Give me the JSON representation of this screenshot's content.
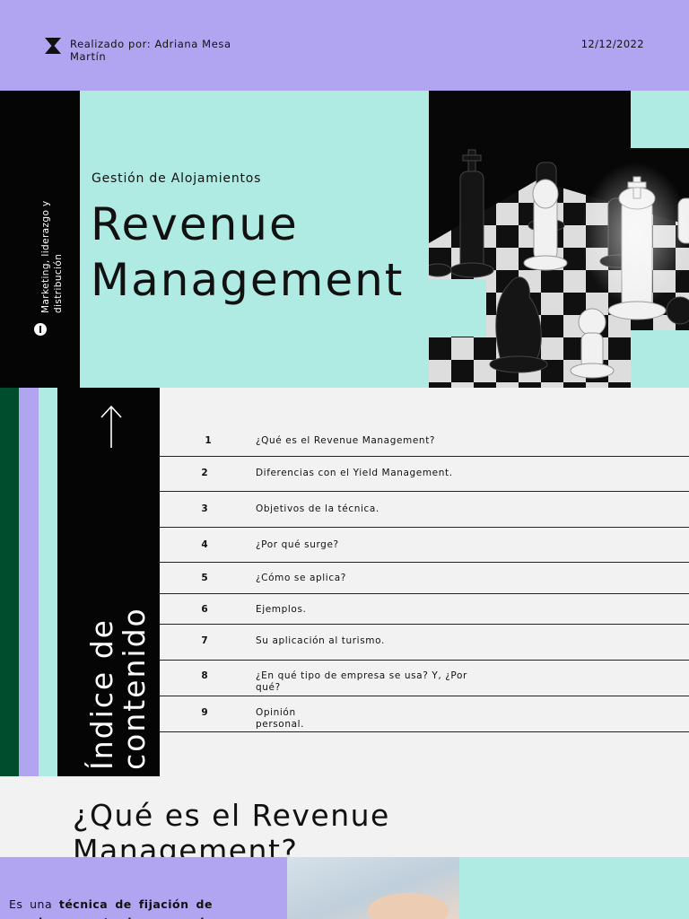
{
  "header": {
    "author": "Realizado por: Adriana Mesa Martín",
    "date": "12/12/2022",
    "icon": "hourglass-icon"
  },
  "sidebar": {
    "vertical_text": "Marketing, liderazgo y distribución",
    "icon": "info-icon"
  },
  "hero": {
    "subtitle": "Gestión de Alojamientos",
    "title": "Revenue Management",
    "image": "chess-pieces-photo"
  },
  "index": {
    "title": "Índice de contenido",
    "icon": "arrow-up-icon",
    "items": [
      {
        "num": "1",
        "text": "¿Qué es el Revenue Management?"
      },
      {
        "num": "2",
        "text": "Diferencias con el Yield Management."
      },
      {
        "num": "3",
        "text": "Objetivos de la técnica."
      },
      {
        "num": "4",
        "text": "¿Por qué surge?"
      },
      {
        "num": "5",
        "text": "¿Cómo se aplica?"
      },
      {
        "num": "6",
        "text": "Ejemplos."
      },
      {
        "num": "7",
        "text": "Su aplicación al turismo."
      },
      {
        "num": "8",
        "text": "¿En qué tipo de empresa se usa? Y, ¿Por qué?"
      },
      {
        "num": "9",
        "text": "Opinión personal."
      }
    ]
  },
  "section1": {
    "title": "¿Qué es el Revenue Management?",
    "body_prefix": "Es una ",
    "body_bold": "técnica de fijación de precios centrada en la gestión de",
    "image": "hand-photo"
  },
  "colors": {
    "lavender": "#b1a5f1",
    "mint": "#afeae3",
    "dark_green": "#004d2e",
    "black": "#050505"
  }
}
